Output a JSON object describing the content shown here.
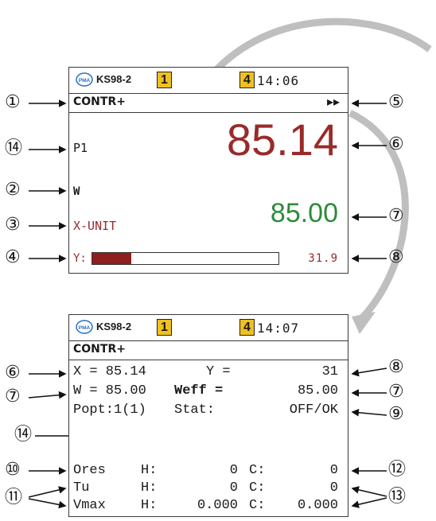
{
  "screen1": {
    "device": "KS98-2",
    "logo_text": "PMA",
    "box_left": "1",
    "box_right": "4",
    "time": "14:06",
    "mode": "CONTR+",
    "mode_indicator": "▸▸",
    "param_label": "P1",
    "main_value": "85.14",
    "w_label": "W",
    "setpoint_value": "85.00",
    "unit_label": "X-UNIT",
    "y_label": "Y:",
    "y_value": "31.9",
    "y_fill_fraction": 0.21,
    "colors": {
      "main": "#9a2a2a",
      "setpoint": "#2e8b3a",
      "unit": "#9a2a2a",
      "bar": "#8e1f1f"
    }
  },
  "screen2": {
    "device": "KS98-2",
    "logo_text": "PMA",
    "box_left": "1",
    "box_right": "4",
    "time": "14:07",
    "mode": "CONTR+",
    "rows": {
      "x_label": "X = 85.14",
      "y_label": "Y =",
      "y_value": "31",
      "w_label": "W = 85.00",
      "weff_label": "Weff =",
      "weff_value": "85.00",
      "popt_label": "Popt:1(1)",
      "stat_label": "Stat:",
      "stat_value": "OFF/OK",
      "ores_label": "Ores",
      "ores_h": "H:",
      "ores_h_val": "0",
      "ores_c": "C:",
      "ores_c_val": "0",
      "tu_label": "Tu",
      "tu_h": "H:",
      "tu_h_val": "0",
      "tu_c": "C:",
      "tu_c_val": "0",
      "vmax_label": "Vmax",
      "vmax_h": "H:",
      "vmax_h_val": "0.000",
      "vmax_c": "C:",
      "vmax_c_val": "0.000"
    }
  },
  "callouts": {
    "c1": "①",
    "c2": "②",
    "c3": "③",
    "c4": "④",
    "c5": "⑤",
    "c6": "⑥",
    "c7": "⑦",
    "c8": "⑧",
    "c14": "⑭",
    "d6": "⑥",
    "d7": "⑦",
    "d8": "⑧",
    "d7b": "⑦",
    "d9": "⑨",
    "d10": "⑩",
    "d11": "⑪",
    "d12": "⑫",
    "d13": "⑬",
    "d14": "⑭"
  },
  "icons": {
    "arrow": "arrow-right-icon",
    "logo": "pma-logo-icon",
    "curve": "curved-arrow-icon"
  }
}
